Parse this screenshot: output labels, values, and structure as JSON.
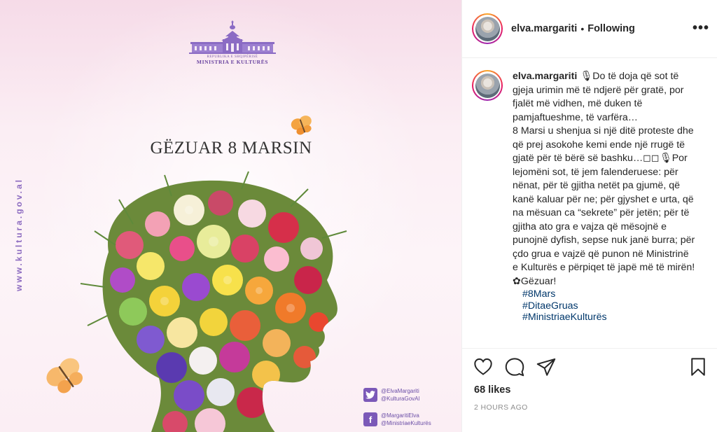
{
  "image": {
    "ministry_small": "REPUBLIKA E SHQIPËRISË",
    "ministry_name": "MINISTRIA E KULTURËS",
    "headline": "GËZUAR 8 MARSIN",
    "vertical_url": "www.kultura.gov.al",
    "social": [
      {
        "icon": "twitter-icon",
        "line1": "@ElvaMargariti",
        "line2": "@KulturaGovAl"
      },
      {
        "icon": "facebook-icon",
        "line1": "@MargaritiElva",
        "line2": "@MinistriaeKulturës"
      }
    ],
    "colors": {
      "accent": "#7b59b8",
      "background": "#f8e4ee"
    }
  },
  "header": {
    "username": "elva.margariti",
    "separator": "•",
    "follow_status": "Following",
    "more": "•••"
  },
  "caption": {
    "username": "elva.margariti",
    "text": "🎙Do të doja që sot të gjeja urimin më të ndjerë për gratë, por fjalët më vidhen, më duken të pamjaftueshme, të varfëra…\n8 Marsi u shenjua si një ditë proteste dhe që prej asokohe kemi ende një rrugë të gjatë për të bërë së bashku…◻◻🎙Por lejomëni sot, të jem falenderuese: për nënat, për të gjitha netët pa gjumë, që kanë kaluar për ne; për gjyshet e urta, që na mësuan ca “sekrete” për jetën; për të gjitha ato gra e vajza që mësojnë e punojnë dyfish, sepse nuk janë burra; për çdo grua e vajzë që punon në Ministrinë e Kulturës e përpiqet të japë më të mirën! ✿Gëzuar!\n",
    "hashtags": [
      "#8Mars",
      "#DitaeGruas",
      "#MinistriaeKulturës"
    ]
  },
  "actions": {
    "likes": "68 likes",
    "time": "2 HOURS AGO"
  }
}
